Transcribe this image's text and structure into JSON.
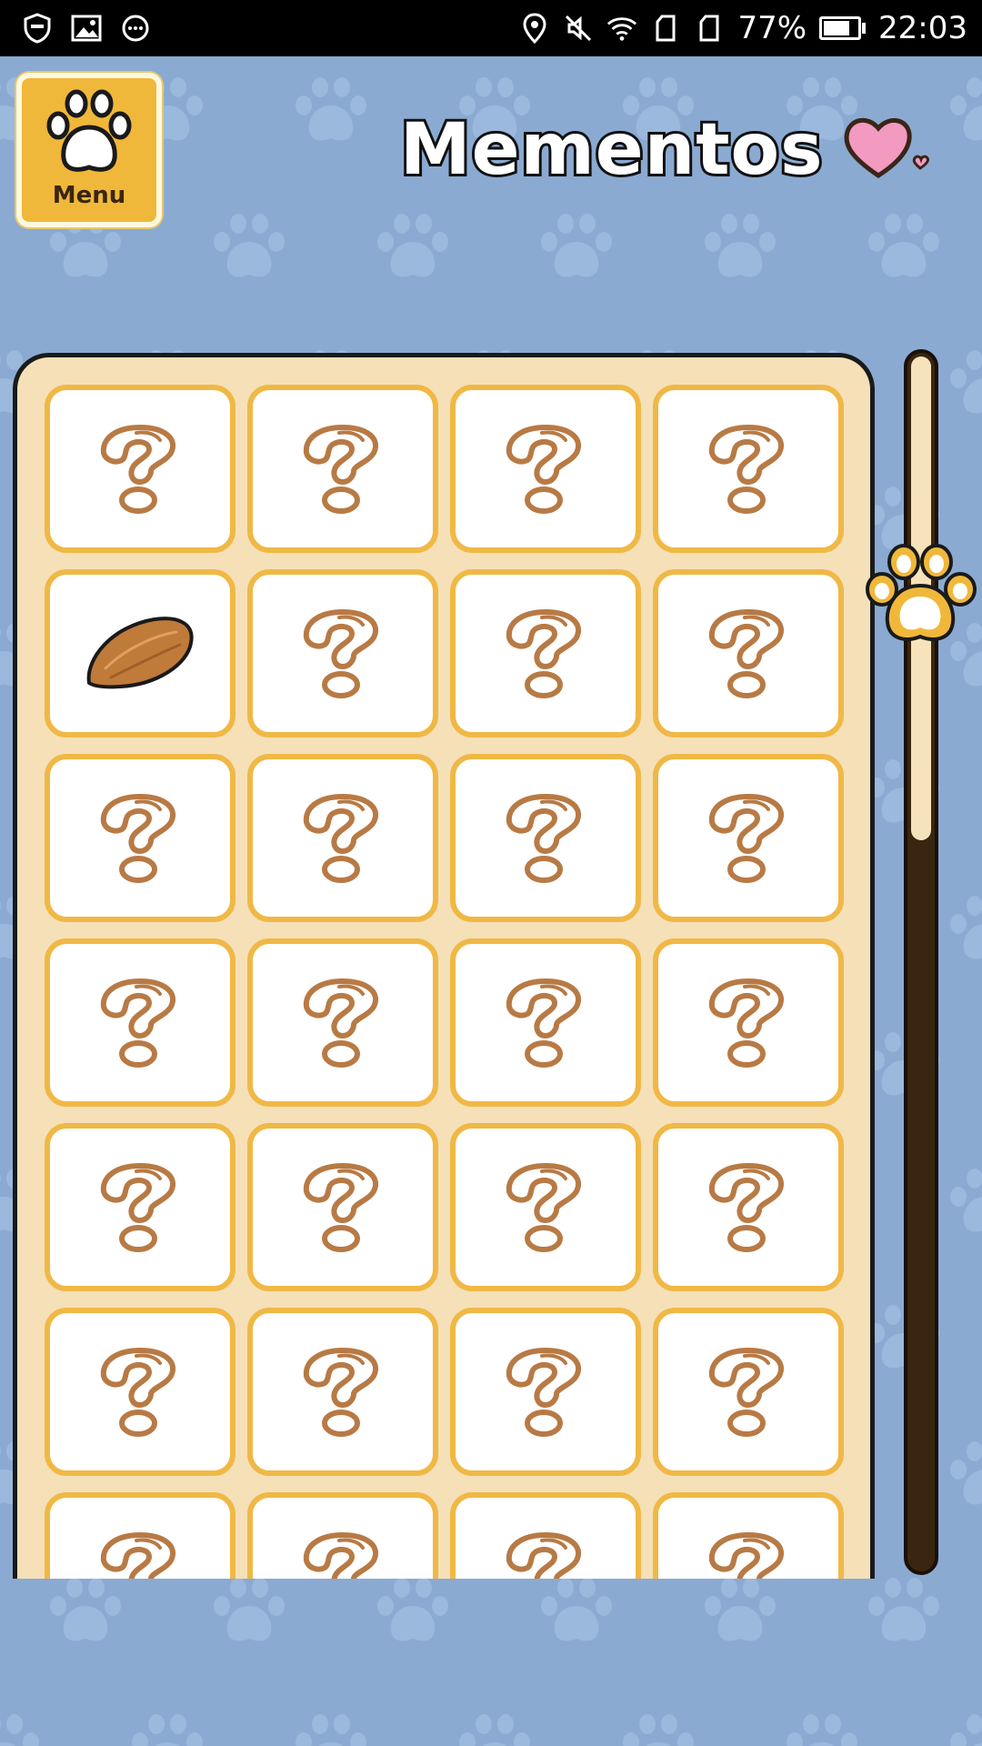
{
  "status_bar": {
    "battery_percent": "77%",
    "time": "22:03",
    "icons_left": [
      "shield-icon",
      "gallery-icon",
      "chat-icon"
    ],
    "icons_right": [
      "location-icon",
      "mute-icon",
      "wifi-icon",
      "sim1-icon",
      "sim2-icon",
      "battery-icon"
    ]
  },
  "header": {
    "menu_label": "Menu",
    "title": "Mementos",
    "heart_color": "#f29ac0"
  },
  "colors": {
    "background": "#8aaad2",
    "panel": "#f5e0b8",
    "cell_border": "#f0b845",
    "question_mark": "#b87a45",
    "menu_button": "#f0b83a"
  },
  "mementos": {
    "columns": 4,
    "rows_visible": 7,
    "items": [
      "unknown",
      "unknown",
      "unknown",
      "unknown",
      "almond",
      "unknown",
      "unknown",
      "unknown",
      "unknown",
      "unknown",
      "unknown",
      "unknown",
      "unknown",
      "unknown",
      "unknown",
      "unknown",
      "unknown",
      "unknown",
      "unknown",
      "unknown",
      "unknown",
      "unknown",
      "unknown",
      "unknown",
      "unknown",
      "unknown",
      "unknown",
      "unknown"
    ]
  },
  "scrollbar": {
    "position_fraction": 0.15
  }
}
